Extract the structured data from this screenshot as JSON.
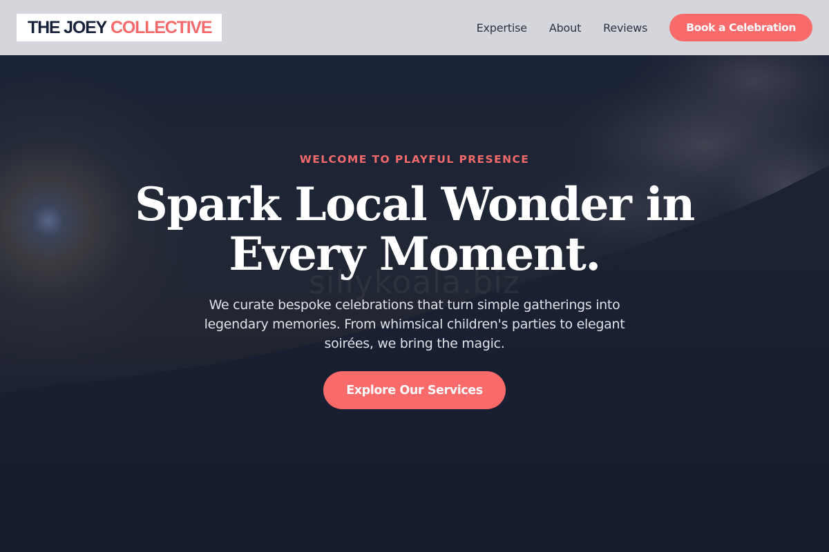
{
  "header": {
    "logo_main": "THE JOEY",
    "logo_accent": "COLLECTIVE",
    "nav": [
      "Expertise",
      "About",
      "Reviews"
    ],
    "cta_label": "Book a Celebration"
  },
  "hero": {
    "eyebrow": "WELCOME TO PLAYFUL PRESENCE",
    "headline_line1": "Spark Local Wonder in",
    "headline_line2": "Every Moment.",
    "subtext": "We curate bespoke celebrations that turn simple gatherings into legendary memories. From whimsical children's parties to elegant soirées, we bring the magic.",
    "button_label": "Explore Our Services",
    "watermark": "sillykoala.biz"
  },
  "colors": {
    "accent": "#f96b6b",
    "navy": "#162039",
    "header_bg": "#d4d6db"
  }
}
